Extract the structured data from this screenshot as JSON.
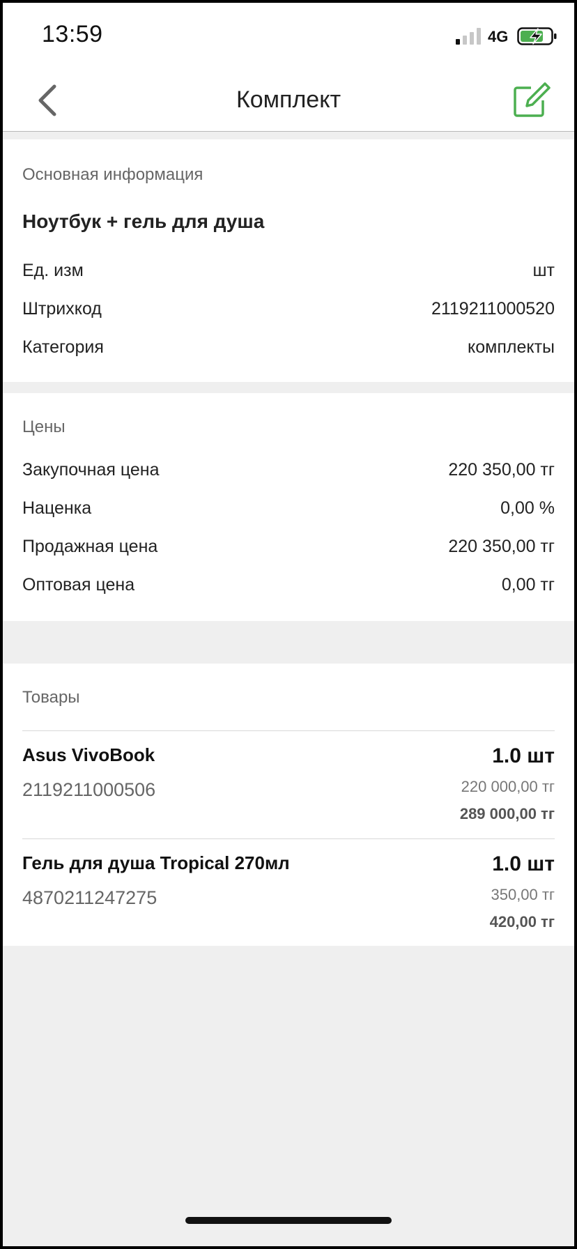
{
  "status_bar": {
    "time": "13:59",
    "network": "4G",
    "icons": [
      "signal-icon",
      "battery-charging-icon"
    ]
  },
  "nav": {
    "title": "Комплект",
    "icons": [
      "back-chevron-icon",
      "edit-icon"
    ],
    "accent_color": "#4caf50"
  },
  "basic_info": {
    "section_title": "Основная информация",
    "product_name": "Ноутбук + гель для душа",
    "rows": [
      {
        "label": "Ед. изм",
        "value": "шт"
      },
      {
        "label": "Штрихкод",
        "value": "2119211000520"
      },
      {
        "label": "Категория",
        "value": "комплекты"
      }
    ]
  },
  "prices": {
    "section_title": "Цены",
    "rows": [
      {
        "label": "Закупочная цена",
        "value": "220 350,00  тг"
      },
      {
        "label": "Наценка",
        "value": "0,00 %"
      },
      {
        "label": "Продажная цена",
        "value": "220 350,00  тг"
      },
      {
        "label": "Оптовая цена",
        "value": "0,00  тг"
      }
    ]
  },
  "goods": {
    "section_title": "Товары",
    "items": [
      {
        "name": "Asus VivoBook",
        "barcode": "2119211000506",
        "quantity": "1.0 шт",
        "purchase_price": "220 000,00 тг",
        "sale_price": "289 000,00 тг"
      },
      {
        "name": "Гель для душа Tropical 270мл",
        "barcode": "4870211247275",
        "quantity": "1.0 шт",
        "purchase_price": "350,00 тг",
        "sale_price": "420,00 тг"
      }
    ]
  }
}
